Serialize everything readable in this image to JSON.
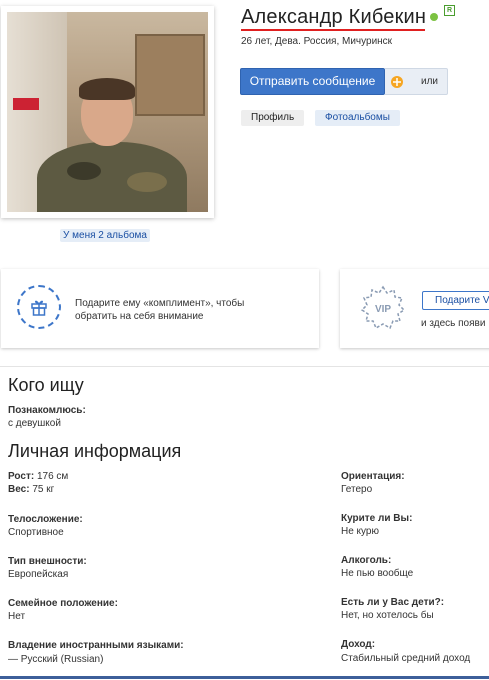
{
  "profile": {
    "name": "Александр Кибекин",
    "status_badge": "R",
    "meta": "26 лет, Дева. Россия, Мичуринск",
    "albums_link": "У меня 2 альбома"
  },
  "actions": {
    "send_message": "Отправить сообщение",
    "or_label": "или",
    "or_icon": "gift-icon"
  },
  "tabs": [
    {
      "label": "Профиль"
    },
    {
      "label": "Фотоальбомы"
    }
  ],
  "promo": {
    "gift_icon": "gift-icon",
    "gift_line1": "Подарите ему «комплимент», чтобы",
    "gift_line2": "обратить на себя внимание",
    "vip_badge": "VIP",
    "vip_button": "Подарите V",
    "vip_text": "и здесь появи"
  },
  "seeking": {
    "heading": "Кого ищу",
    "label": "Познакомлюсь:",
    "value": "с девушкой"
  },
  "personal": {
    "heading": "Личная информация",
    "height_label": "Рост:",
    "height_value": "176 см",
    "weight_label": "Вес:",
    "weight_value": "75 кг",
    "left": [
      {
        "label": "Телосложение:",
        "value": "Спортивное"
      },
      {
        "label": "Тип внешности:",
        "value": "Европейская"
      },
      {
        "label": "Семейное положение:",
        "value": "Нет"
      },
      {
        "label": "Владение иностранными языками:",
        "value": "— Русский (Russian)"
      }
    ],
    "right": [
      {
        "label": "Ориентация:",
        "value": "Гетеро"
      },
      {
        "label": "Курите ли Вы:",
        "value": "Не курю"
      },
      {
        "label": "Алкоголь:",
        "value": "Не пью вообще"
      },
      {
        "label": "Есть ли у Вас дети?:",
        "value": "Нет, но хотелось бы"
      },
      {
        "label": "Доход:",
        "value": "Стабильный средний доход"
      }
    ]
  },
  "colors": {
    "accent": "#3d76c9",
    "link": "#1a4fa3",
    "online": "#7cc242",
    "name_underline": "#e02020"
  }
}
